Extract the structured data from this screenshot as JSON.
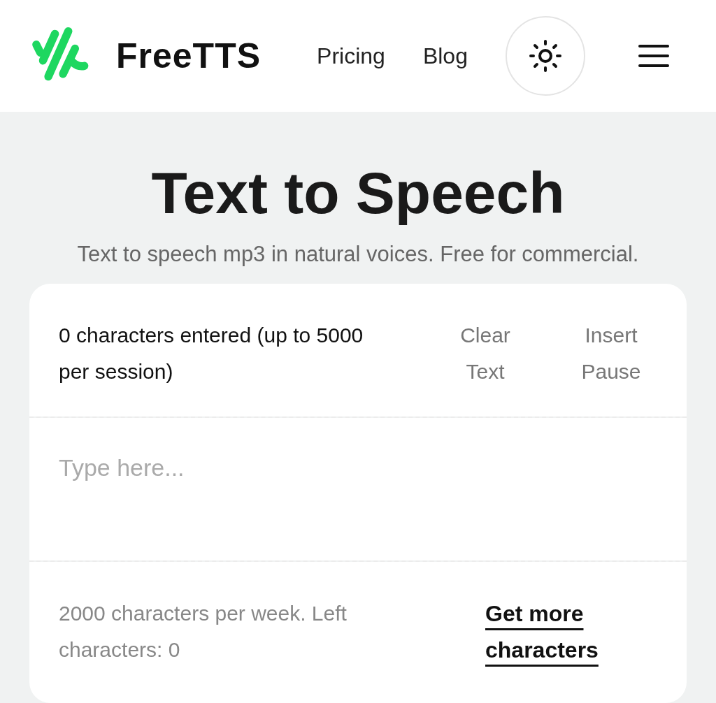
{
  "header": {
    "logo_text": "FreeTTS",
    "nav": [
      "Pricing",
      "Blog"
    ]
  },
  "title": "Text to Speech",
  "subtitle": "Text to speech mp3 in natural voices. Free for commercial.",
  "editor": {
    "count_text": "0 characters entered (up to 5000 per session)",
    "actions": [
      "Clear Text",
      "Insert Pause"
    ],
    "placeholder": "Type here...",
    "quota_text": "2000 characters per week. Left characters: 0",
    "upgrade_link": "Get more characters"
  }
}
